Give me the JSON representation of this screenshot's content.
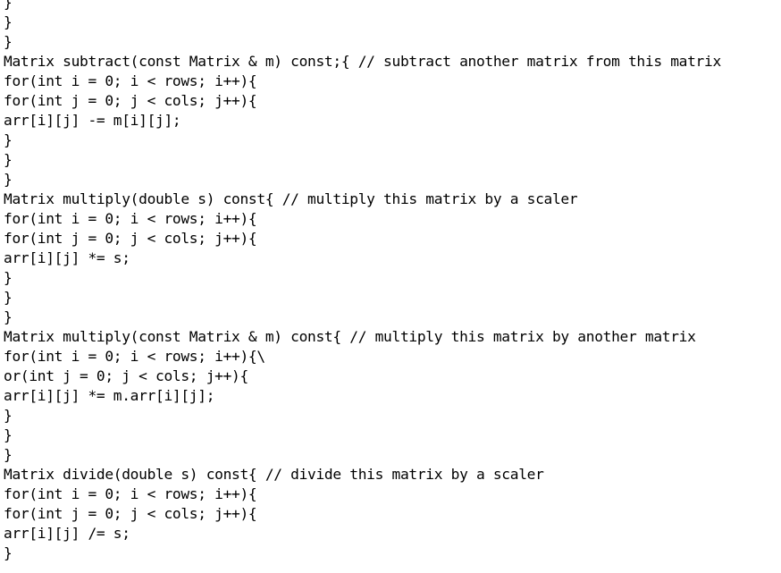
{
  "code": {
    "lines": [
      "}",
      "}",
      "}",
      "Matrix subtract(const Matrix & m) const;{ // subtract another matrix from this matrix",
      "for(int i = 0; i < rows; i++){",
      "for(int j = 0; j < cols; j++){",
      "arr[i][j] -= m[i][j];",
      "}",
      "}",
      "}",
      "Matrix multiply(double s) const{ // multiply this matrix by a scaler",
      "for(int i = 0; i < rows; i++){",
      "for(int j = 0; j < cols; j++){",
      "arr[i][j] *= s;",
      "}",
      "}",
      "}",
      "Matrix multiply(const Matrix & m) const{ // multiply this matrix by another matrix",
      "for(int i = 0; i < rows; i++){\\",
      "or(int j = 0; j < cols; j++){",
      "arr[i][j] *= m.arr[i][j];",
      "}",
      "}",
      "}",
      "Matrix divide(double s) const{ // divide this matrix by a scaler",
      "for(int i = 0; i < rows; i++){",
      "for(int j = 0; j < cols; j++){",
      "arr[i][j] /= s;",
      "}"
    ]
  }
}
